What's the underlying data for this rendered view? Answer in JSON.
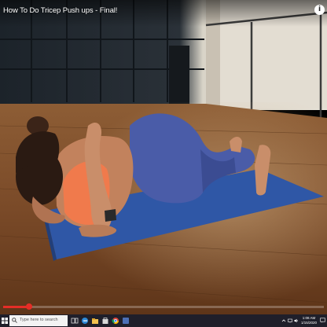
{
  "video": {
    "title": "How To Do Tricep Push ups - Final!",
    "info_glyph": "i",
    "progress_fraction": 0.08
  },
  "taskbar": {
    "search_placeholder": "Type here to search",
    "time": "1:08 AM",
    "date": "1/15/2020"
  },
  "colors": {
    "progress": "#e52d27",
    "taskbar": "#1f1f2a",
    "mat": "#2f57a6",
    "leggings": "#4a5ca8",
    "sports_bra": "#f07a4c",
    "floor": "#8a5a34"
  }
}
